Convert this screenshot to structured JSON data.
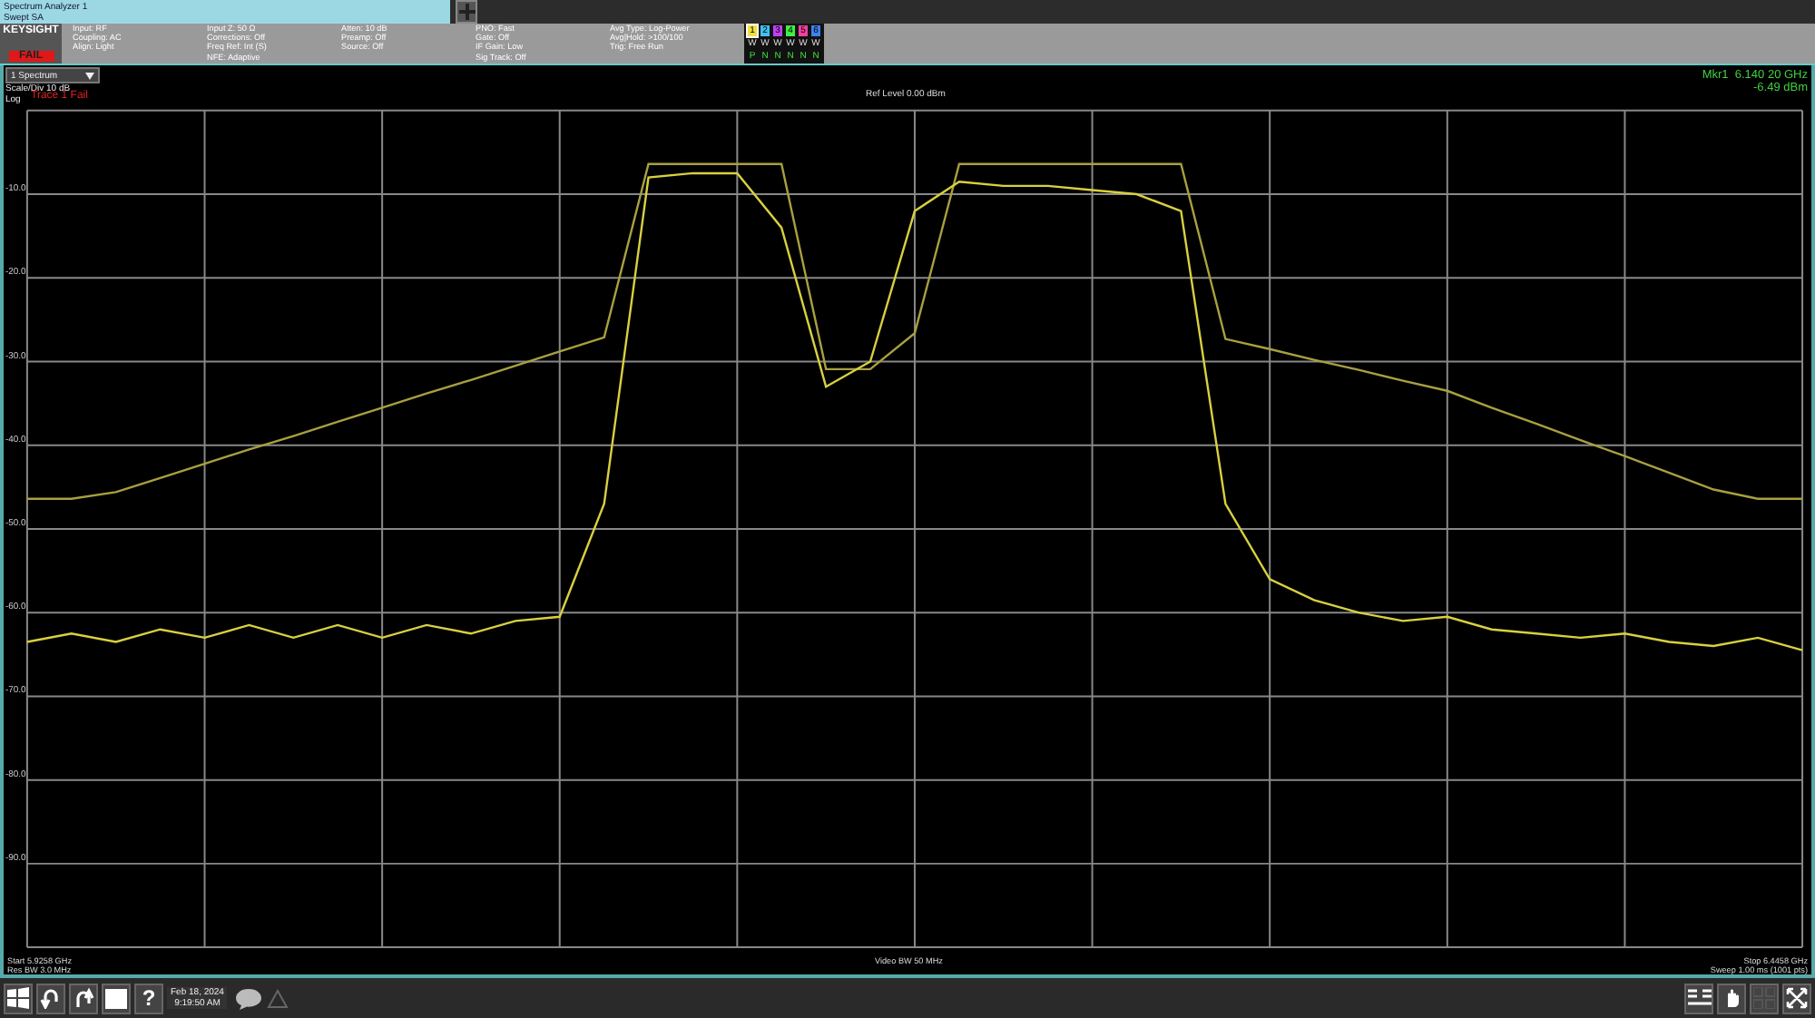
{
  "tab": {
    "title": "Spectrum Analyzer 1",
    "subtitle": "Swept SA"
  },
  "header": {
    "logo": "KEYSIGHT",
    "status": "FAIL",
    "columns": [
      [
        "Input: RF",
        "Coupling: AC",
        "Align: Light"
      ],
      [
        "Input Z: 50 Ω",
        "Corrections: Off",
        "Freq Ref: Int (S)",
        "NFE: Adaptive"
      ],
      [
        "Atten: 10 dB",
        "Preamp: Off",
        "Source: Off"
      ],
      [
        "PNO: Fast",
        "Gate: Off",
        "IF Gain: Low",
        "Sig Track: Off"
      ],
      [
        "Avg Type: Log-Power",
        "Avg|Hold: >100/100",
        "Trig: Free Run"
      ]
    ],
    "traces": [
      {
        "number": "1",
        "color": "#f0e040",
        "type": "W",
        "detector": "P"
      },
      {
        "number": "2",
        "color": "#40c0f0",
        "type": "W",
        "detector": "N"
      },
      {
        "number": "3",
        "color": "#c040f0",
        "type": "W",
        "detector": "N"
      },
      {
        "number": "4",
        "color": "#40f040",
        "type": "W",
        "detector": "N"
      },
      {
        "number": "5",
        "color": "#f040a0",
        "type": "W",
        "detector": "N"
      },
      {
        "number": "6",
        "color": "#4080f0",
        "type": "W",
        "detector": "N"
      }
    ]
  },
  "view_selector": "1 Spectrum",
  "scale": "Scale/Div 10 dB",
  "scale_type": "Log",
  "trace_status": "Trace 1 Fail",
  "ref_level": "Ref Level 0.00 dBm",
  "marker": {
    "label": "Mkr1",
    "frequency": "6.140 20 GHz",
    "amplitude": "-6.49 dBm"
  },
  "chart_data": {
    "type": "line",
    "ylim": [
      -100,
      0
    ],
    "grid": true,
    "yticks": [
      {
        "value": -10,
        "label": "-10.0"
      },
      {
        "value": -20,
        "label": "-20.0"
      },
      {
        "value": -30,
        "label": "-30.0"
      },
      {
        "value": -40,
        "label": "-40.0"
      },
      {
        "value": -50,
        "label": "-50.0"
      },
      {
        "value": -60,
        "label": "-60.0"
      },
      {
        "value": -70,
        "label": "-70.0"
      },
      {
        "value": -80,
        "label": "-80.0"
      },
      {
        "value": -90,
        "label": "-90.0"
      }
    ],
    "series": [
      {
        "color": "#a8a040",
        "values": [
          -46.4,
          -46.4,
          -45.6,
          -43.9,
          -42.2,
          -40.5,
          -38.9,
          -37.2,
          -35.5,
          -33.8,
          -32.2,
          -30.5,
          -28.8,
          -27.1,
          -6.4,
          -6.4,
          -6.4,
          -6.4,
          -30.9,
          -30.9,
          -26.6,
          -6.4,
          -6.4,
          -6.4,
          -6.4,
          -6.4,
          -6.4,
          -27.3,
          -28.5,
          -29.8,
          -31.0,
          -32.3,
          -33.5,
          -35.5,
          -37.4,
          -39.4,
          -41.3,
          -43.3,
          -45.3,
          -46.4,
          -46.4
        ]
      },
      {
        "color": "#d8d040",
        "values": [
          -63.5,
          -62.5,
          -63.5,
          -62,
          -63,
          -61.5,
          -63,
          -61.5,
          -63,
          -61.5,
          -62.5,
          -61,
          -60.5,
          -47,
          -8,
          -7.5,
          -7.5,
          -14,
          -33,
          -30,
          -12,
          -8.5,
          -9,
          -9,
          -9.5,
          -10,
          -12,
          -47,
          -56,
          -58.5,
          -60,
          -61,
          -60.5,
          -62,
          -62.5,
          -63,
          -62.5,
          -63.5,
          -64,
          -63,
          -64.5
        ]
      }
    ]
  },
  "footer": {
    "start": "Start 5.9258 GHz",
    "rbw": "Res BW 3.0 MHz",
    "vbw": "Video BW 50 MHz",
    "stop": "Stop 6.4458 GHz",
    "sweep": "Sweep 1.00 ms (1001 pts)"
  },
  "taskbar": {
    "help": "?",
    "date": "Feb 18, 2024",
    "time": "9:19:50 AM"
  }
}
